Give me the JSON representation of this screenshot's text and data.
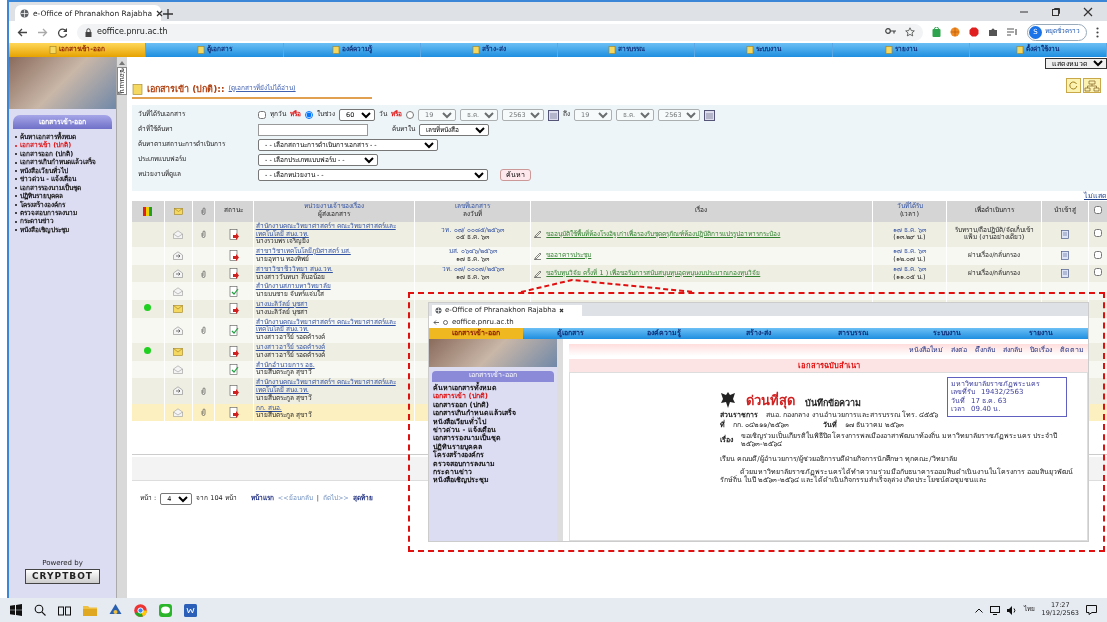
{
  "browser": {
    "tab_title": "e-Office of Phranakhon Rajabha",
    "address": "eoffice.pnru.ac.th",
    "profile_initial": "S",
    "profile_status": "หยุดชั่วคราว"
  },
  "nav": [
    {
      "label": "เอกสารเข้า-ออก",
      "selected": true
    },
    {
      "label": "ตู้เอกสาร",
      "selected": false
    },
    {
      "label": "องค์ความรู้",
      "selected": false
    },
    {
      "label": "สร้าง-ส่ง",
      "selected": false
    },
    {
      "label": "สารบรรณ",
      "selected": false
    },
    {
      "label": "ระบบงาน",
      "selected": false
    },
    {
      "label": "รายงาน",
      "selected": false
    },
    {
      "label": "ตั้งค่าใช้งาน",
      "selected": false
    }
  ],
  "sidebar": {
    "hide_tab": "ซ่อนเมนู",
    "header": "เอกสารเข้า-ออก",
    "items": [
      {
        "label": "ค้นหาเอกสารทั้งหมด",
        "selected": false
      },
      {
        "label": "เอกสารเข้า (ปกติ)",
        "selected": true
      },
      {
        "label": "เอกสารออก (ปกติ)",
        "selected": false
      },
      {
        "label": "เอกสารเกินกำหนดแล้วเสร็จ",
        "selected": false
      },
      {
        "label": "หนังสือเวียนทั่วไป",
        "selected": false
      },
      {
        "label": "ข่าวด่วน - แจ้งเตือน",
        "selected": false
      },
      {
        "label": "เอกสารรองนามเป็นชุด",
        "selected": false
      },
      {
        "label": "ปฏิทินรายบุคคล",
        "selected": false
      },
      {
        "label": "โครงสร้างองค์กร",
        "selected": false
      },
      {
        "label": "ตรวจสอบการลงนาม",
        "selected": false
      },
      {
        "label": "กระดานข่าว",
        "selected": false
      },
      {
        "label": "หนังสือเชิญประชุม",
        "selected": false
      }
    ],
    "powered_by": "Powered by",
    "brand": "CRYPTBOT"
  },
  "category_select": "แสดงหมวด",
  "page": {
    "title": "เอกสารเข้า (ปกติ)::",
    "subtitle": "(ดูเอกสารที่ยังไม่ได้อ่าน)"
  },
  "search": {
    "date_label": "วันที่ได้รับเอกสาร",
    "all_days": {
      "label": "ทุกวัน",
      "checked": false
    },
    "or_1": "หรือ",
    "range": {
      "label": "ในช่วง",
      "selected": true,
      "days": "60",
      "unit": "วัน"
    },
    "or_2": "หรือ",
    "between": {
      "selected": false,
      "from": [
        "19",
        "ธ.ค.",
        "2563"
      ],
      "to_label": "ถึง",
      "to": [
        "19",
        "ธ.ค.",
        "2563"
      ]
    },
    "keyword_label": "คำที่ใช้ค้นหา",
    "search_in_label": "ค้นหาใน",
    "search_in": "เลขที่หนังสือ",
    "status_label": "ค้นหาตามสถานะการดำเนินการ",
    "status_select": "- - เลือกสถานะการดำเนินการเอกสาร - -",
    "form_label": "ประเภทแบบฟอร์ม",
    "form_select": "- - เลือกประเภทแบบฟอร์ม - -",
    "unit_label": "หน่วยงานที่ดูแล",
    "unit_select": "- - เลือกหน่วยงาน - -",
    "button": "ค้นหา"
  },
  "hide_link": "ไม่แสด",
  "table": {
    "columns": [
      {
        "kind": "flag"
      },
      {
        "kind": "mail"
      },
      {
        "kind": "clip"
      },
      {
        "kind": "text",
        "label": "สถานะ"
      },
      {
        "kind": "text",
        "label": "หน่วยงานเจ้าของเรื่อง",
        "sub": "ผู้ส่งเอกสาร"
      },
      {
        "kind": "text",
        "label": "เลขที่เอกสาร",
        "sub": "ลงวันที่"
      },
      {
        "kind": "text",
        "label": "เรื่อง"
      },
      {
        "kind": "text",
        "label": "วันที่ได้รับ",
        "sub": "(เวลา)"
      },
      {
        "kind": "text",
        "label": "เพื่อดำเนินการ"
      },
      {
        "kind": "text",
        "label": "นำเข้าสู่"
      },
      {
        "kind": "check",
        "checked": false
      }
    ],
    "rows": [
      {
        "new": false,
        "read": true,
        "forwarded": false,
        "attachment": true,
        "done": false,
        "unit": "สำนักงานคณะวิทยาศาสตร์ฯ คณะวิทยาศาสตร์และเทคโนโลยี สนง.วท.",
        "sender": "นางรวมพร เจริญยิ่ง",
        "doc_no": "วท. ๐๗/ ๐๐๘๕/๒๕๖๓",
        "date": "๐๕ ธ.ค. ๖๓",
        "subject": "ขออนุมัติใช้พื้นที่ห้องโรงอิฐเก่าเพื่อรองรับชุดครุภัณฑ์ห้องปฏิบัติการแปรรูปอาหารกระป๋อง",
        "received": "๑๗ ธ.ค. ๖๓",
        "time": "(๑๓.๒๙ น.)",
        "action": "รับทราบ/ถือปฏิบัติ/จัดเก็บเข้าแฟ้ม (งานอย่างเดียว)",
        "checked": false,
        "selected": false
      },
      {
        "new": false,
        "read": true,
        "forwarded": true,
        "attachment": false,
        "done": false,
        "unit": "สาขาวิชาเทคโนโลยีภูมิศาสตร์ มส.",
        "sender": "นายอุทาน ทองทิพย์",
        "doc_no": "มส. ๐๖๔๖/๒๕๖๓",
        "date": "๑๗ ธ.ค. ๖๓",
        "subject": "ขออาคารประชุม",
        "received": "๑๗ ธ.ค. ๖๓",
        "time": "(๑๒.๐๗ น.)",
        "action": "ผ่านเรื่อง/กลั่นกรอง",
        "checked": false,
        "selected": false
      },
      {
        "new": false,
        "read": true,
        "forwarded": true,
        "attachment": true,
        "done": false,
        "unit": "สาขาวิชาชีววิทยา สนง.วท.",
        "sender": "นางสาววันทนา ลีบอน้อย",
        "doc_no": "วท. ๐๗/ ๐๐๐๗/๒๕๖๓",
        "date": "๑๗ ธ.ค. ๖๓",
        "subject": "ขอรับทุนวิจัย ครั้งที่ 1 ) เพื่อขอรับการสนับสนุนทุนอุดหนุนงบประมาณกองทุนวิจัย",
        "received": "๑๗ ธ.ค. ๖๓",
        "time": "(๑๑.๐๕ น.)",
        "action": "ผ่านเรื่อง/กลั่นกรอง",
        "checked": false,
        "selected": false
      },
      {
        "new": false,
        "read": true,
        "forwarded": false,
        "attachment": false,
        "done": true,
        "unit": "สำนักงานสภามหาวิทยาลัย",
        "sender": "นายมนชาย จันทร์แจ่มใส",
        "selected": false
      },
      {
        "new": true,
        "read": false,
        "attachment": false,
        "done": false,
        "unit": "นางมะลิวัลย์ นุชสา",
        "sender": "นางมะลิวัลย์ นุชสา",
        "selected": false
      },
      {
        "new": false,
        "read": true,
        "forwarded": true,
        "attachment": true,
        "done": true,
        "unit": "สำนักงานคณะวิทยาศาสตร์ฯ คณะวิทยาศาสตร์และเทคโนโลยี สนง.วท.",
        "sender": "นางสาวอารีย์ รอดคำรงค์",
        "selected": false
      },
      {
        "new": true,
        "read": false,
        "attachment": false,
        "done": false,
        "unit": "นางสาวอารีย์ รอดคำรงค์",
        "sender": "นางสาวอารีย์ รอดคำรงค์",
        "selected": false
      },
      {
        "new": false,
        "read": true,
        "forwarded": false,
        "attachment": false,
        "done": true,
        "unit": "สำนักอำนวยการ อธ.",
        "sender": "นายสืบตระกูล สุขาวี",
        "selected": false
      },
      {
        "new": false,
        "read": true,
        "forwarded": true,
        "attachment": true,
        "done": false,
        "unit": "สำนักงานคณะวิทยาศาสตร์ฯ คณะวิทยาศาสตร์และเทคโนโลยี สนง.วท.",
        "sender": "นายสืบตระกูล สุขาวี",
        "selected": false
      },
      {
        "new": false,
        "read": true,
        "forwarded": false,
        "attachment": true,
        "done": false,
        "unit": "กก. สนอ.",
        "sender": "นายสืบตระกูล สุขาวี",
        "selected": true
      }
    ]
  },
  "pagination": {
    "label": "หน้า :",
    "page": "4",
    "total": "จาก 104 หน้า",
    "links": [
      {
        "kind": "link",
        "label": "หน้าแรก",
        "bold": true
      },
      {
        "kind": "link",
        "label": "<<ย้อนกลับ",
        "bold": false
      },
      {
        "kind": "separator",
        "label": "|"
      },
      {
        "kind": "link",
        "label": "ถัดไป>>",
        "bold": false
      },
      {
        "kind": "link",
        "label": "สุดท้าย",
        "bold": true
      }
    ]
  },
  "inset": {
    "tab_title": "e-Office of Phranakhon Rajabha",
    "address": "eoffice.pnru.ac.th",
    "nav": [
      {
        "label": "เอกสารเข้า-ออก",
        "selected": true
      },
      {
        "label": "ตู้เอกสาร",
        "selected": false
      },
      {
        "label": "องค์ความรู้",
        "selected": false
      },
      {
        "label": "สร้าง-ส่ง",
        "selected": false
      },
      {
        "label": "สารบรรณ",
        "selected": false
      },
      {
        "label": "ระบบงาน",
        "selected": false
      },
      {
        "label": "รายงาน",
        "selected": false
      }
    ],
    "sidebar_header": "เอกสารเข้า-ออก",
    "sidebar_items": [
      {
        "label": "ค้นหาเอกสารทั้งหมด",
        "selected": false
      },
      {
        "label": "เอกสารเข้า (ปกติ)",
        "selected": true
      },
      {
        "label": "เอกสารออก (ปกติ)",
        "selected": false
      },
      {
        "label": "เอกสารเกินกำหนดแล้วเสร็จ",
        "selected": false
      },
      {
        "label": "หนังสือเวียนทั่วไป",
        "selected": false
      },
      {
        "label": "ข่าวด่วน - แจ้งเตือน",
        "selected": false
      },
      {
        "label": "เอกสารรองนามเป็นชุด",
        "selected": false
      },
      {
        "label": "ปฏิทินรายบุคคล",
        "selected": false
      },
      {
        "label": "โครงสร้างองค์กร",
        "selected": false
      },
      {
        "label": "ตรวจสอบการลงนาม",
        "selected": false
      },
      {
        "label": "กระดานข่าว",
        "selected": false
      },
      {
        "label": "หนังสือเชิญประชุม",
        "selected": false
      }
    ],
    "toolbar": [
      "หนังสือใหม่",
      "ส่งต่อ",
      "ดึงกลับ",
      "ส่งกลับ",
      "ปิดเรื่อง",
      "ติดตาม"
    ],
    "header": "เอกสารฉบับสำเนา",
    "stamp": {
      "title": "มหาวิทยาลัยราชภัฏพระนคร",
      "rows": [
        [
          "เลขที่รับ",
          "19432/2563"
        ],
        [
          "วันที่",
          "17 ธ.ค. 63"
        ],
        [
          "เวลา",
          "09.40 น."
        ]
      ]
    },
    "urgency": "ด่วนที่สุด",
    "doc_title": "บันทึกข้อความ",
    "fields": [
      {
        "label": "ส่วนราชการ",
        "value": "สนอ. กองกลาง งานอำนวยการและสารบรรณ โทร. ๔๕๕๖"
      },
      {
        "label": "ที่",
        "value": "กก. ๐๔๒๑๑/๒๕๖๓",
        "label2": "วันที่",
        "value2": "๑๗ ธันวาคม ๒๕๖๓"
      },
      {
        "label": "เรื่อง",
        "value": "ขอเชิญร่วมเป็นเกียรติในพิธีปิดโครงการพลเมืองอาสาพัฒนาท้องถิ่น มหาวิทยาลัยราชภัฏพระนคร ประจำปี ๒๕๖๓-๒๕๖๔"
      }
    ],
    "salutation": "เรียน  คณบดี/ผู้อำนวยการ/ผู้ช่วยอธิการบดีฝ่ายกิจการนักศึกษา ทุกคณะ/วิทยาลัย",
    "body": "ด้วยมหาวิทยาลัยราชภัฏพระนครได้ทำความร่วมมือกับธนาคารออมสินดำเนินงานในโครงการ ออมสินยุวพัฒน์รักษ์ถิ่น ในปี ๒๕๖๓-๒๕๖๔ และได้ดำเนินกิจกรรมสำเร็จลุล่วง เกิดประโยชน์ต่อชุมชนและ"
  },
  "taskbar": {
    "language": "ไทย",
    "time": "17:27",
    "date": "19/12/2563"
  }
}
